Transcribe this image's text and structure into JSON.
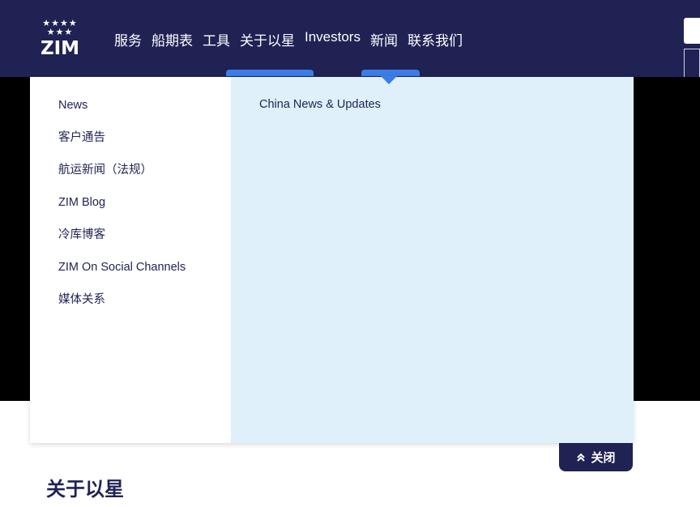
{
  "header": {
    "logo_text": "ZIM",
    "logo_stars": "★★★★\n★★★",
    "nav": [
      "服务",
      "船期表",
      "工具",
      "关于以星",
      "Investors",
      "新闻",
      "联系我们"
    ]
  },
  "dropdown": {
    "left_items": [
      "News",
      "客户通告",
      "航运新闻（法规）",
      "ZIM Blog",
      "冷库博客",
      "ZIM On Social Channels",
      "媒体关系"
    ],
    "right_items": [
      "China News & Updates"
    ]
  },
  "close_tab": {
    "icon": "double-chevron-up-icon",
    "label": "关闭"
  },
  "section": {
    "title": "关于以星"
  },
  "colors": {
    "navy": "#1f2253",
    "accent_blue": "#3b7de6",
    "panel_light_blue": "#dff0fa"
  }
}
